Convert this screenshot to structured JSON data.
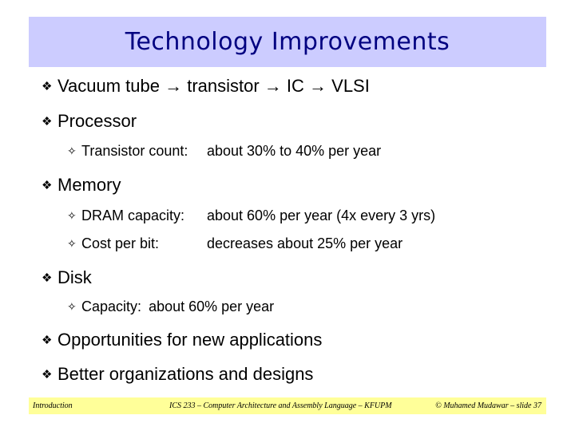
{
  "slide": {
    "title": "Technology Improvements",
    "bullets": [
      {
        "marker": "❖",
        "text": "Vacuum tube → transistor → IC → VLSI"
      },
      {
        "marker": "❖",
        "text": "Processor"
      },
      {
        "marker": "❖",
        "text": "Memory"
      },
      {
        "marker": "❖",
        "text": "Disk"
      },
      {
        "marker": "❖",
        "text": "Opportunities for new applications"
      },
      {
        "marker": "❖",
        "text": "Better organizations and designs"
      }
    ],
    "processor_sub": [
      {
        "marker": "✧",
        "label": "Transistor count:",
        "value": "about 30% to 40% per year"
      }
    ],
    "memory_sub": [
      {
        "marker": "✧",
        "label": "DRAM capacity:",
        "value": "about 60% per year (4x every 3 yrs)"
      },
      {
        "marker": "✧",
        "label": "Cost per bit:",
        "value": "decreases about 25% per year"
      }
    ],
    "disk_sub": [
      {
        "marker": "✧",
        "label": "Capacity:",
        "value": "about 60% per year"
      }
    ]
  },
  "footer": {
    "left": "Introduction",
    "center": "ICS 233 – Computer Architecture and Assembly Language – KFUPM",
    "right": "© Muhamed Mudawar – slide 37"
  },
  "colors": {
    "title_banner": "#ccccff",
    "title_text": "#000080",
    "footer_bar": "#ffff99"
  }
}
